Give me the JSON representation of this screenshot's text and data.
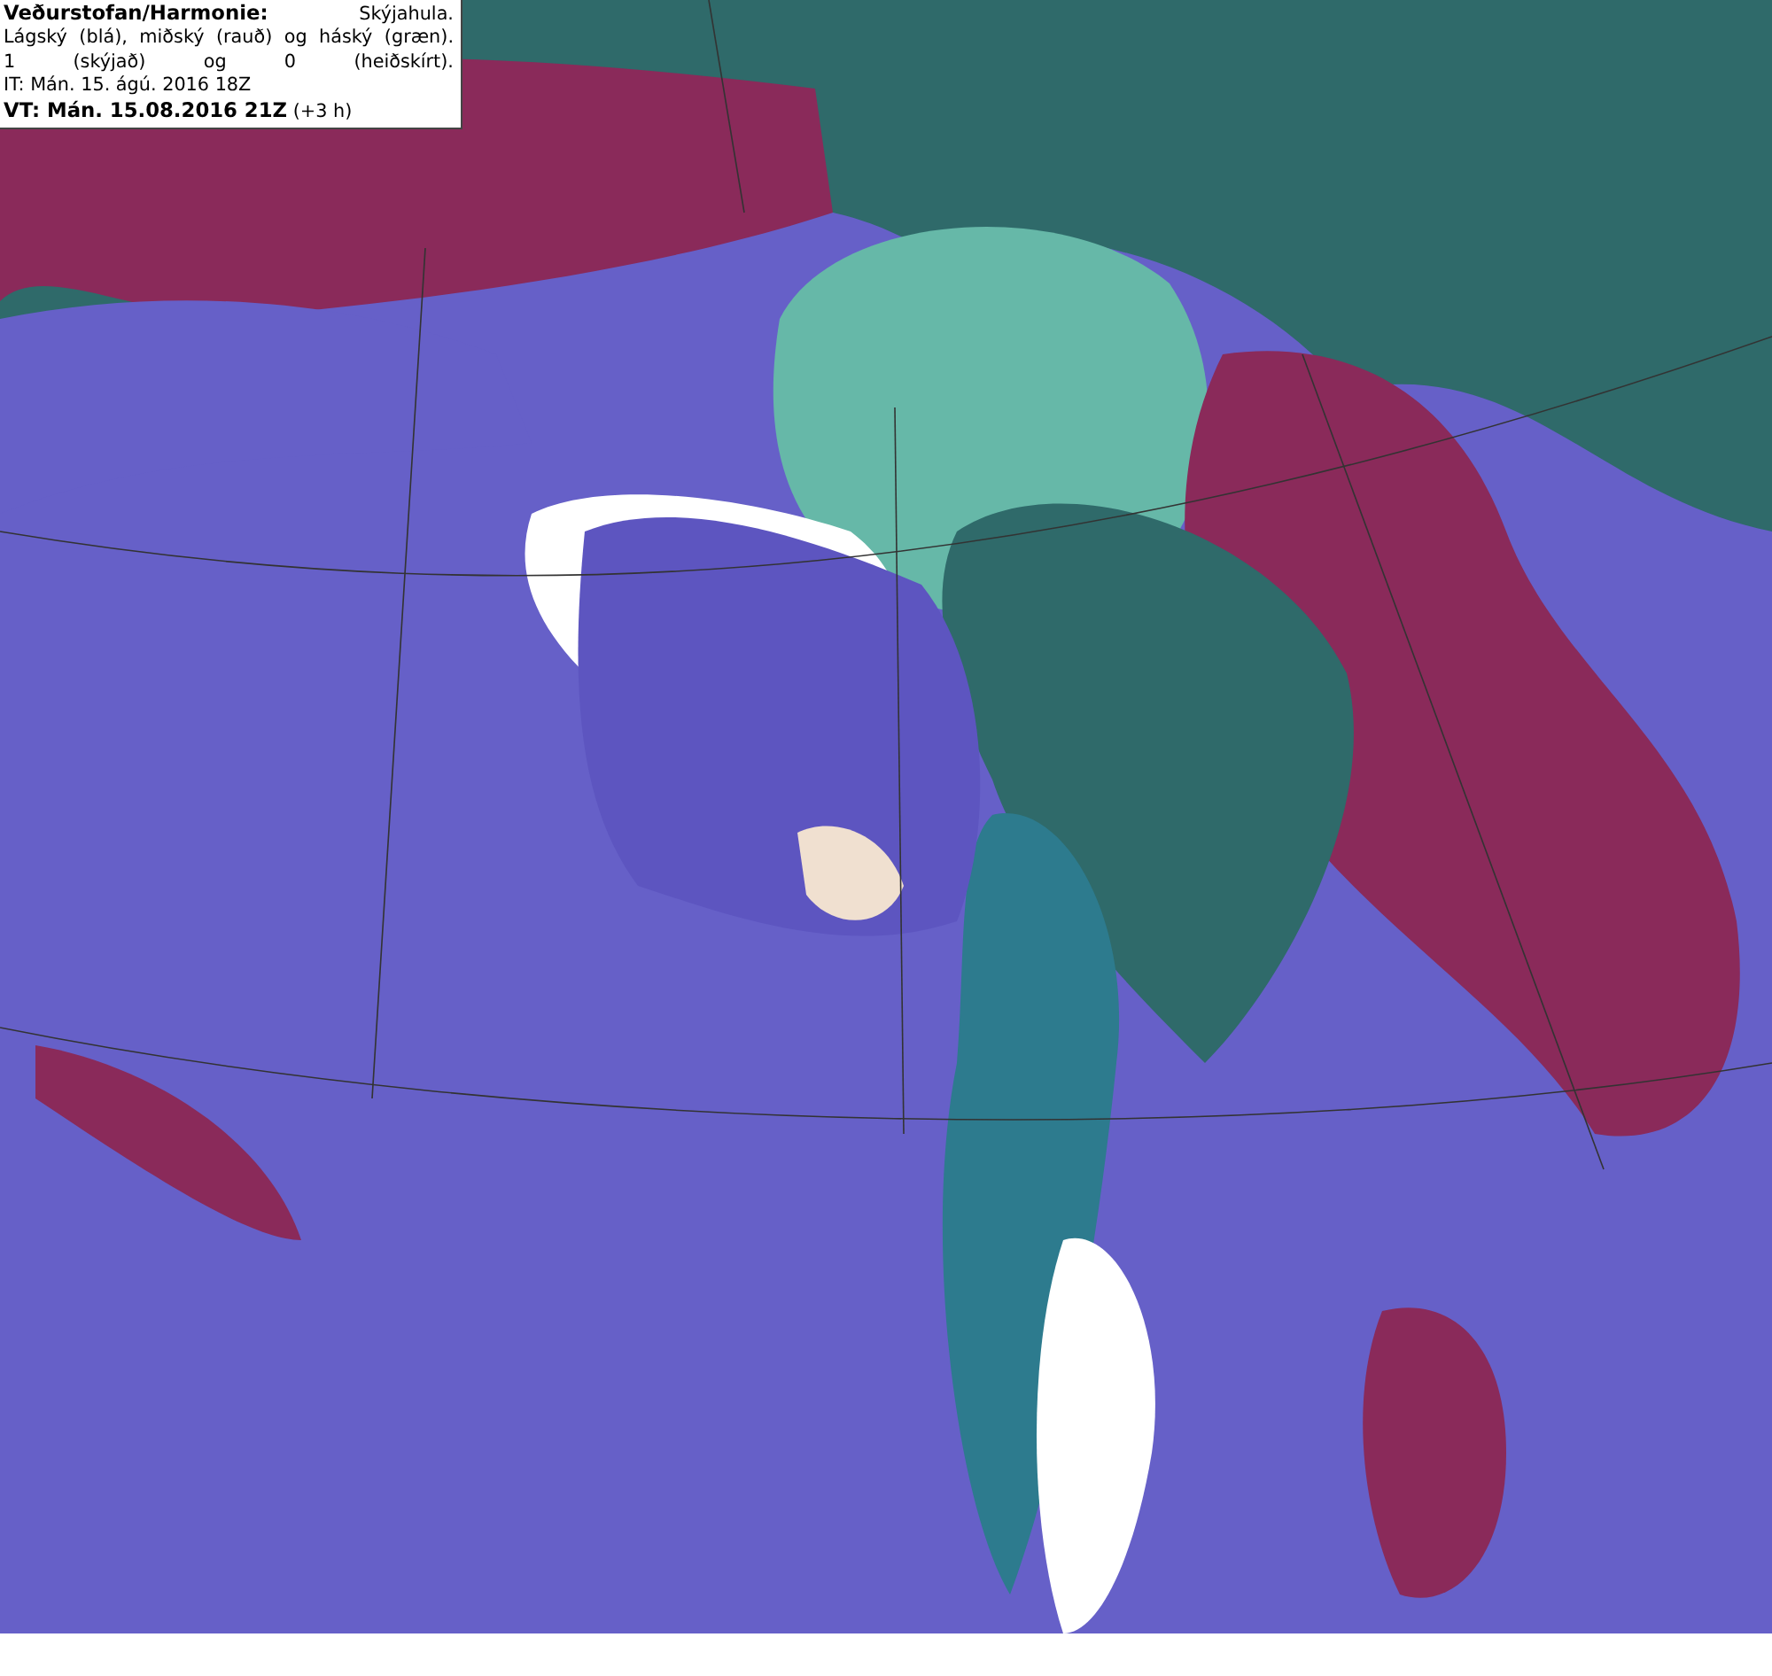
{
  "legend": {
    "lines": [
      {
        "text": "**Veðurstofan/Harmonie:** Skýjahula."
      },
      {
        "text": "Lágský (blá), miðský (rauð) og háský (græn)."
      },
      {
        "text": "1 (skýjað) og 0 (heiðskírt)."
      },
      {
        "text": "IT: Mán. 15. ágú. 2016 18Z"
      },
      {
        "text": "**VT: Mán. 15.08.2016 21Z** (+3 h)"
      }
    ]
  }
}
